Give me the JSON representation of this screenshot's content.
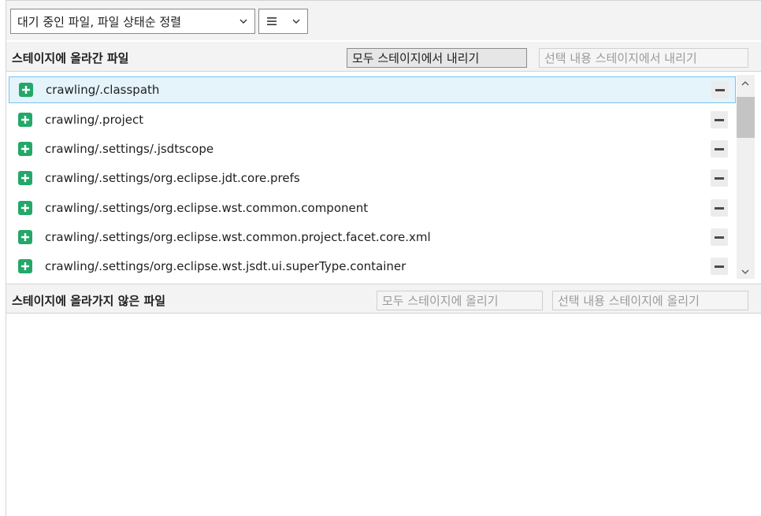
{
  "toolbar": {
    "sort_dropdown": "대기 중인 파일, 파일 상태순 정렬",
    "view_dropdown_icon": "list-lines-icon"
  },
  "staged": {
    "title": "스테이지에 올라간 파일",
    "unstage_all_label": "모두 스테이지에서 내리기",
    "unstage_selected_label": "선택 내용 스테이지에서 내리기",
    "files": [
      {
        "name": "crawling/.classpath",
        "status_icon": "added-icon"
      },
      {
        "name": "crawling/.project",
        "status_icon": "added-icon"
      },
      {
        "name": "crawling/.settings/.jsdtscope",
        "status_icon": "added-icon"
      },
      {
        "name": "crawling/.settings/org.eclipse.jdt.core.prefs",
        "status_icon": "added-icon"
      },
      {
        "name": "crawling/.settings/org.eclipse.wst.common.component",
        "status_icon": "added-icon"
      },
      {
        "name": "crawling/.settings/org.eclipse.wst.common.project.facet.core.xml",
        "status_icon": "added-icon"
      },
      {
        "name": "crawling/.settings/org.eclipse.wst.jsdt.ui.superType.container",
        "status_icon": "added-icon"
      }
    ]
  },
  "unstaged": {
    "title": "스테이지에 올라가지 않은 파일",
    "stage_all_label": "모두 스테이지에 올리기",
    "stage_selected_label": "선택 내용 스테이지에 올리기",
    "files": []
  },
  "colors": {
    "added": "#23a869",
    "selection_bg": "#e5f3fb",
    "selection_border": "#7ac3ea",
    "header_bg": "#f3f3f3"
  }
}
